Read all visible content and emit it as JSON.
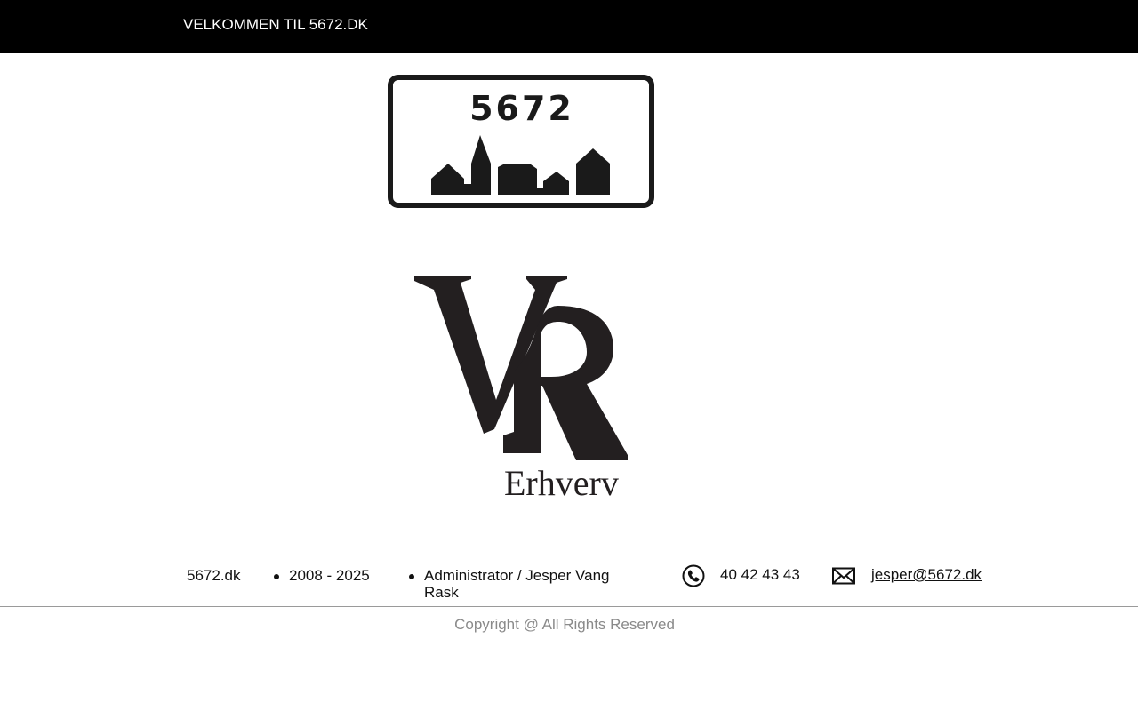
{
  "header": {
    "title": "VELKOMMEN TIL 5672.DK"
  },
  "town_sign": {
    "postcode": "5672"
  },
  "logo": {
    "monogram": "VR",
    "wordmark": "Erhverv"
  },
  "footer": {
    "site_name": "5672.dk",
    "years": "2008 - 2025",
    "administrator": "Administrator / Jesper Vang Rask",
    "phone": "40 42 43 43",
    "email": "jesper@5672.dk",
    "copyright": "Copyright @ All Rights Reserved"
  },
  "colors": {
    "topbar": "#000000",
    "sign_ink": "#1a1a1a",
    "logo_ink": "#231f20",
    "copyright_text": "#8a8a8a"
  },
  "icons": {
    "phone": "phone-icon",
    "mail": "mail-icon"
  }
}
